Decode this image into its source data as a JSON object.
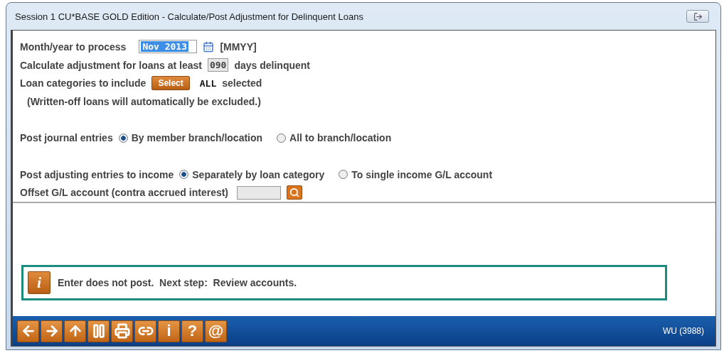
{
  "window": {
    "title": "Session 1 CU*BASE GOLD Edition - Calculate/Post Adjustment for Delinquent Loans"
  },
  "month": {
    "label": "Month/year to process",
    "value": "Nov 2013",
    "hint": "[MMYY]"
  },
  "days": {
    "label": "Calculate adjustment for loans at least",
    "value": "090",
    "suffix": "days delinquent"
  },
  "categories": {
    "label": "Loan categories to include",
    "button": "Select",
    "value": "ALL",
    "suffix": "selected"
  },
  "note": "(Written-off loans will automatically be excluded.)",
  "radio_groups": [
    {
      "label": "Post journal entries",
      "options": [
        {
          "label": "By member branch/location",
          "selected": true
        },
        {
          "label": "All to branch/location",
          "selected": false
        }
      ]
    },
    {
      "label": "Post adjusting entries to income",
      "options": [
        {
          "label": "Separately by loan category",
          "selected": true
        },
        {
          "label": "To single income G/L account",
          "selected": false
        }
      ]
    }
  ],
  "offset": {
    "label": "Offset G/L account (contra accrued interest)"
  },
  "message": {
    "icon": "i",
    "text": "Enter does not post.  Next step:  Review accounts."
  },
  "toolbar": [
    {
      "kind": "back"
    },
    {
      "kind": "forward"
    },
    {
      "kind": "up"
    },
    {
      "kind": "pause"
    },
    {
      "kind": "print"
    },
    {
      "kind": "link"
    },
    {
      "kind": "text",
      "label": "i"
    },
    {
      "kind": "text",
      "label": "?"
    },
    {
      "kind": "text",
      "label": "@"
    }
  ],
  "status": "WU (3988)"
}
